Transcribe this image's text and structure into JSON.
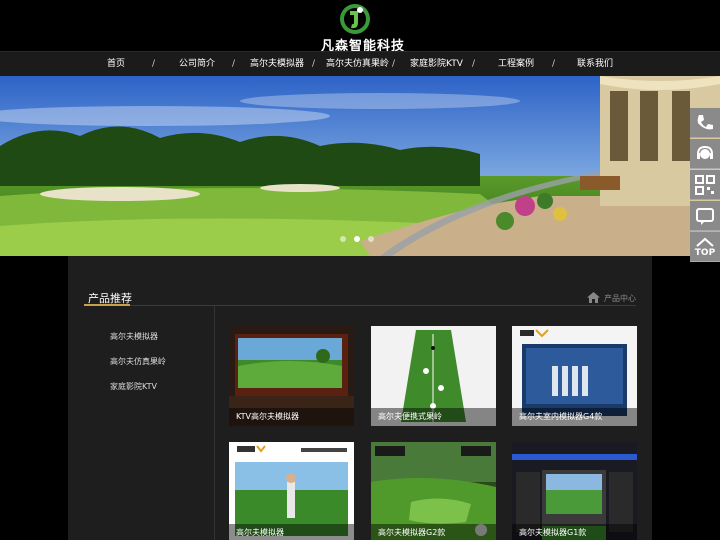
{
  "brand": {
    "name": "凡森智能科技",
    "accent": "#2e8b2e"
  },
  "nav": {
    "items": [
      "首页",
      "公司简介",
      "高尔夫模拟器",
      "高尔夫仿真果岭",
      "家庭影院KTV",
      "工程案例",
      "联系我们"
    ],
    "separator": "/"
  },
  "banner": {
    "slides": 3,
    "active_slide": 1
  },
  "float_bar": {
    "top_label": "TOP"
  },
  "section": {
    "title": "产品推荐",
    "breadcrumb": "产品中心"
  },
  "sidebar": {
    "items": [
      "高尔夫模拟器",
      "高尔夫仿真果岭",
      "家庭影院KTV"
    ]
  },
  "products": [
    {
      "caption": "KTV高尔夫模拟器",
      "icon": "golf-room-image"
    },
    {
      "caption": "高尔夫便携式果岭",
      "icon": "putting-green-image"
    },
    {
      "caption": "高尔夫室内模拟器G4款",
      "icon": "simulator-g4-image"
    },
    {
      "caption": "高尔夫模拟器",
      "icon": "birdie-screen-image"
    },
    {
      "caption": "高尔夫模拟器G2款",
      "icon": "simulator-g2-image"
    },
    {
      "caption": "高尔夫模拟器G1款",
      "icon": "simulator-g1-image"
    }
  ]
}
